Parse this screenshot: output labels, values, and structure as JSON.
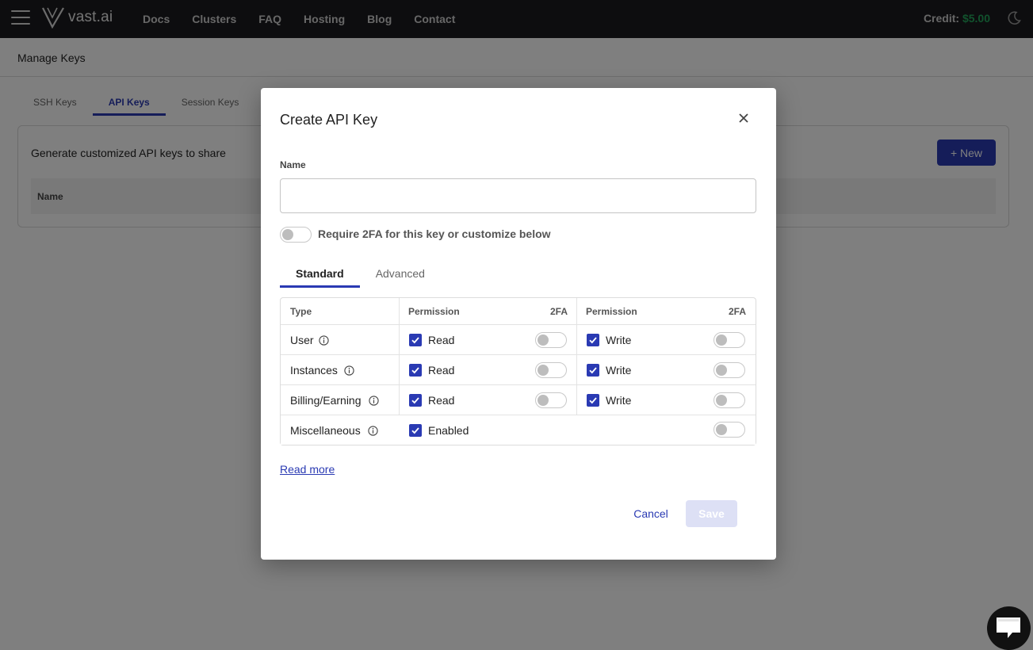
{
  "nav": {
    "logo_text": "vast.ai",
    "links": [
      "Docs",
      "Clusters",
      "FAQ",
      "Hosting",
      "Blog",
      "Contact"
    ],
    "credit_label": "Credit:",
    "credit_amount": "$5.00"
  },
  "page": {
    "title": "Manage Keys",
    "tabs": [
      "SSH Keys",
      "API Keys",
      "Session Keys"
    ],
    "active_tab": "API Keys",
    "card_title": "Generate customized API keys to share",
    "new_button": "+ New",
    "table_header_name": "Name"
  },
  "modal": {
    "title": "Create API Key",
    "name_label": "Name",
    "name_value": "",
    "require_2fa_label": "Require 2FA for this key or customize below",
    "require_2fa_on": false,
    "tabs": [
      "Standard",
      "Advanced"
    ],
    "active_tab": "Standard",
    "columns": {
      "type": "Type",
      "permission_1": "Permission",
      "twofa_1": "2FA",
      "permission_2": "Permission",
      "twofa_2": "2FA"
    },
    "rows": [
      {
        "type": "User",
        "perm1": "Read",
        "perm1_checked": true,
        "perm1_2fa": false,
        "perm2": "Write",
        "perm2_checked": true,
        "perm2_2fa": false
      },
      {
        "type": "Instances",
        "perm1": "Read",
        "perm1_checked": true,
        "perm1_2fa": false,
        "perm2": "Write",
        "perm2_checked": true,
        "perm2_2fa": false
      },
      {
        "type": "Billing/Earning",
        "perm1": "Read",
        "perm1_checked": true,
        "perm1_2fa": false,
        "perm2": "Write",
        "perm2_checked": true,
        "perm2_2fa": false
      },
      {
        "type": "Miscellaneous",
        "perm1": "Enabled",
        "perm1_checked": true,
        "perm1_2fa": false
      }
    ],
    "read_more": "Read more",
    "cancel": "Cancel",
    "save": "Save"
  },
  "colors": {
    "accent": "#2a3ab3",
    "credit_green": "#23a55a",
    "topbar": "#1b1b1f"
  },
  "icons": [
    "menu-icon",
    "vast-logo-icon",
    "moon-icon",
    "close-icon",
    "info-icon",
    "checkbox-checked-icon",
    "chat-icon"
  ]
}
